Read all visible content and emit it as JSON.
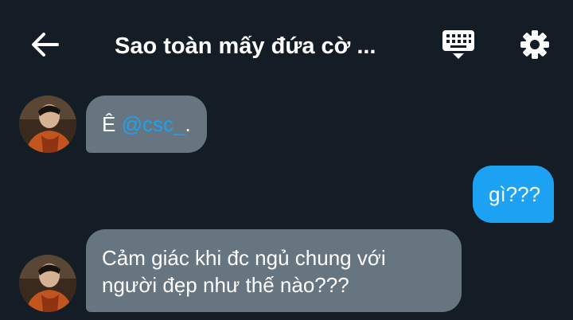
{
  "header": {
    "title": "Sao toàn mấy đứa cờ ...",
    "icons": {
      "back": "arrow-left-icon",
      "keyboard": "keyboard-icon",
      "settings": "gear-icon"
    }
  },
  "messages": [
    {
      "direction": "incoming",
      "prefix": "Ê ",
      "mention": "@csc_",
      "suffix": "."
    },
    {
      "direction": "outgoing",
      "text": "gì???"
    },
    {
      "direction": "incoming",
      "lines": [
        "Cảm giác khi đc ngủ chung với",
        "người đẹp như thế nào???"
      ]
    }
  ],
  "colors": {
    "background": "#141d26",
    "incoming_bubble": "#66757f",
    "outgoing_bubble": "#1da1f2",
    "mention": "#1da1f2",
    "text": "#ffffff"
  }
}
